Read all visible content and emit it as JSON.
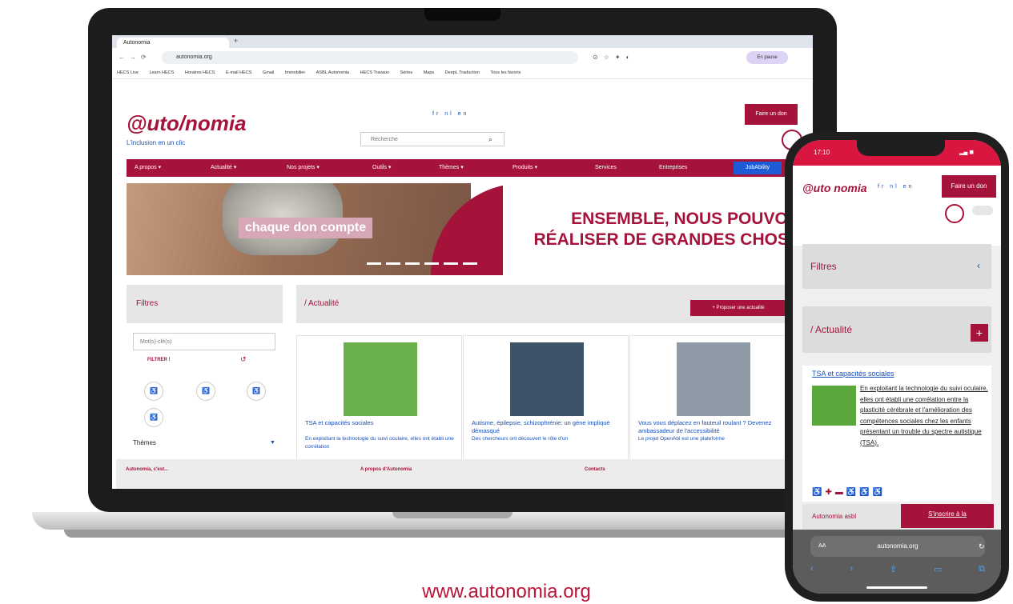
{
  "browser": {
    "tab_title": "Autonomia",
    "new_tab": "+",
    "address": "autonomia.org",
    "profile_status": "En pause",
    "bookmarks": [
      "HECS Live",
      "Learn HECS",
      "Horaires HECS",
      "E-mail HECS",
      "Gmail",
      "Immobilier",
      "ASBL Autonomia",
      "HECS Travaux",
      "Séries",
      "Maps",
      "DeepL Traduction",
      "Tous les favoris"
    ]
  },
  "site": {
    "logo": "@uto/nomia",
    "tagline": "L'inclusion en un clic",
    "languages": [
      "fr",
      "nl",
      "en"
    ],
    "search_placeholder": "Recherche",
    "donate_label": "Faire un don",
    "menu": [
      "A propos ▾",
      "Actualité ▾",
      "Nos projets ▾",
      "Outils ▾",
      "Thèmes ▾",
      "Produits ▾",
      "Services",
      "Entreprises"
    ],
    "jobability": "JobAbility",
    "banner": {
      "caption": "chaque don compte",
      "headline_1": "ENSEMBLE, NOUS POUVONS",
      "headline_2": "RÉALISER DE GRANDES CHOSES"
    },
    "sidebar": {
      "title": "Filtres",
      "keyword_placeholder": "Mot(s)-clé(s)",
      "filter_button": "FILTRER !",
      "themes_label": "Thèmes"
    },
    "main": {
      "title": "/ Actualité",
      "propose_button": "+ Proposer une actualité"
    },
    "cards": [
      {
        "title": "TSA et capacités sociales",
        "body": "En exploitant la technologie du suivi oculaire, elles ont établi une corrélation"
      },
      {
        "title": "Autisme, épilepsie, schizophrénie: un gène impliqué démasqué",
        "body": "Des chercheurs ont découvert le rôle d'un"
      },
      {
        "title": "Vous vous déplacez en fauteuil roulant ? Devenez ambassadeur de l'accessibilité",
        "body": "Le projet OpenAbl est une plateforme"
      }
    ],
    "footer": [
      "Autonomia, c'est...",
      "A propos d'Autonomia",
      "Contacts"
    ]
  },
  "phone": {
    "time": "17:10",
    "logo": "@uto nomia",
    "languages": [
      "fr",
      "nl",
      "en"
    ],
    "donate_label": "Faire un don",
    "filters": "Filtres",
    "news": "/ Actualité",
    "card_title": "TSA et capacités sociales",
    "card_body": "En exploitant la technologie du suivi oculaire, elles ont établi une corrélation entre la plasticité cérébrale et l'amélioration des compétences sociales chez les enfants présentant un trouble du spectre autistique (TSA).",
    "footer_left": "Autonomia asbl",
    "footer_right": "S'inscrire à la",
    "url_aa": "AA",
    "url": "autonomia.org"
  },
  "caption": "www.autonomia.org",
  "colors": {
    "brand": "#a5123a",
    "link": "#1a4fb3"
  }
}
